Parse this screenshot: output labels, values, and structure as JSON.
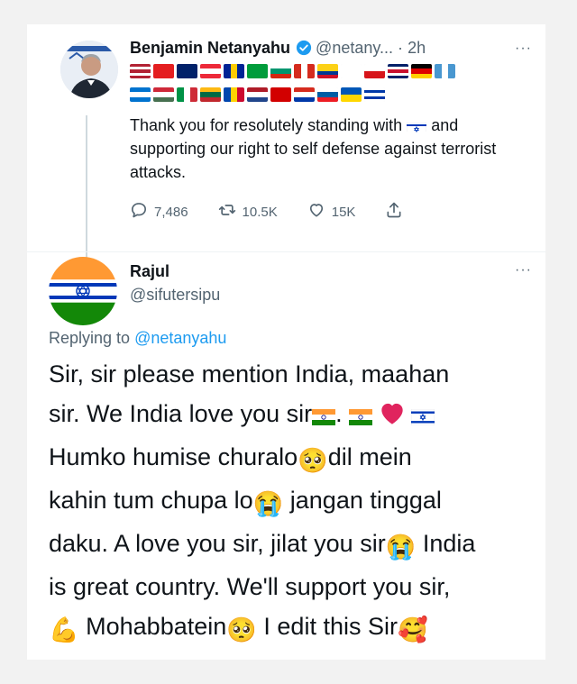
{
  "tweet": {
    "author_name": "Benjamin Netanyahu",
    "author_handle": "@netany...",
    "separator": "·",
    "time": "2h",
    "more_label": "···",
    "text_before_flag": "Thank you for resolutely standing with",
    "text_after_flag": "and supporting our right to self defense against terrorist attacks.",
    "stats": {
      "replies": "7,486",
      "retweets": "10.5K",
      "likes": "15K"
    },
    "flag_rows": [
      [
        {
          "name": "usa",
          "stripes": [
            "#b22234",
            "#ffffff",
            "#b22234",
            "#ffffff",
            "#b22234"
          ],
          "dir": "h"
        },
        {
          "name": "albania",
          "stripes": [
            "#e41e20"
          ],
          "dir": "h"
        },
        {
          "name": "australia",
          "stripes": [
            "#012169"
          ],
          "dir": "h"
        },
        {
          "name": "austria",
          "stripes": [
            "#ed2939",
            "#ffffff",
            "#ed2939"
          ],
          "dir": "h"
        },
        {
          "name": "bosnia",
          "stripes": [
            "#002395",
            "#fecb00",
            "#002395"
          ],
          "dir": "v"
        },
        {
          "name": "brazil",
          "stripes": [
            "#009c3b"
          ],
          "dir": "h"
        },
        {
          "name": "bulgaria",
          "stripes": [
            "#ffffff",
            "#00966e",
            "#d62612"
          ],
          "dir": "h"
        },
        {
          "name": "canada",
          "stripes": [
            "#d52b1e",
            "#ffffff",
            "#d52b1e"
          ],
          "dir": "v"
        },
        {
          "name": "colombia",
          "stripes": [
            "#fcd116",
            "#fcd116",
            "#003893",
            "#ce1126"
          ],
          "dir": "h"
        },
        {
          "name": "cyprus",
          "stripes": [
            "#ffffff"
          ],
          "dir": "h"
        },
        {
          "name": "czechia",
          "stripes": [
            "#ffffff",
            "#d7141a"
          ],
          "dir": "h"
        },
        {
          "name": "uk",
          "stripes": [
            "#012169",
            "#ffffff",
            "#c8102e",
            "#ffffff",
            "#012169"
          ],
          "dir": "h"
        },
        {
          "name": "germany",
          "stripes": [
            "#000000",
            "#dd0000",
            "#ffce00"
          ],
          "dir": "h"
        },
        {
          "name": "guatemala",
          "stripes": [
            "#4997d0",
            "#ffffff",
            "#4997d0"
          ],
          "dir": "v"
        }
      ],
      [
        {
          "name": "honduras",
          "stripes": [
            "#0073cf",
            "#ffffff",
            "#0073cf"
          ],
          "dir": "h"
        },
        {
          "name": "hungary",
          "stripes": [
            "#ce2939",
            "#ffffff",
            "#477050"
          ],
          "dir": "h"
        },
        {
          "name": "italy",
          "stripes": [
            "#009246",
            "#ffffff",
            "#ce2b37"
          ],
          "dir": "v"
        },
        {
          "name": "lithuania",
          "stripes": [
            "#fdb913",
            "#006a44",
            "#c1272d"
          ],
          "dir": "h"
        },
        {
          "name": "moldova",
          "stripes": [
            "#0046ae",
            "#ffd200",
            "#cc092f"
          ],
          "dir": "v"
        },
        {
          "name": "netherlands",
          "stripes": [
            "#ae1c28",
            "#ffffff",
            "#21468b"
          ],
          "dir": "h"
        },
        {
          "name": "north-macedonia",
          "stripes": [
            "#d20000"
          ],
          "dir": "h"
        },
        {
          "name": "paraguay",
          "stripes": [
            "#d52b1e",
            "#ffffff",
            "#0038a8"
          ],
          "dir": "h"
        },
        {
          "name": "slovenia",
          "stripes": [
            "#ffffff",
            "#005da4",
            "#ed1c24"
          ],
          "dir": "h"
        },
        {
          "name": "ukraine",
          "stripes": [
            "#0057b7",
            "#ffd700"
          ],
          "dir": "h"
        },
        {
          "name": "uruguay",
          "stripes": [
            "#ffffff",
            "#0038a8",
            "#ffffff",
            "#0038a8",
            "#ffffff"
          ],
          "dir": "h"
        }
      ]
    ]
  },
  "reply": {
    "author_name": "Rajul",
    "author_handle": "@sifutersipu",
    "more_label": "···",
    "replying_prefix": "Replying to",
    "replying_to": "@netanyahu",
    "lines": [
      "Sir, sir please mention India, maahan",
      "sir. We India love you sir",
      "Humko humise churalo",
      "kahin tum chupa lo",
      "daku. A love you sir, jilat you sir",
      "is great country. We'll support you sir,",
      "Mohabbatein"
    ],
    "segments": {
      "l2_dot": ".",
      "l3_after": "dil mein",
      "l4_after": "jangan tinggal",
      "l5_after": "India",
      "l7_after": "I edit this Sir"
    },
    "emojis": {
      "pleading": "🥺",
      "crying": "😭",
      "heart": "❤",
      "muscle": "💪",
      "smiling_hearts": "🥰"
    }
  },
  "colors": {
    "accent_blue": "#1d9bf0",
    "text_primary": "#0f1419",
    "text_secondary": "#536471",
    "heart_red": "#e0245e"
  }
}
